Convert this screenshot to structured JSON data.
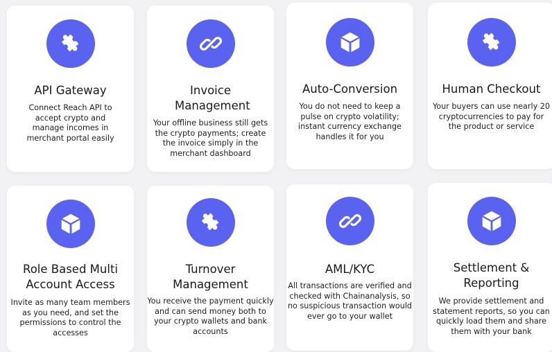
{
  "colors": {
    "page_background": "#f2f2f4",
    "card_background": "#ffffff",
    "icon_accent": "#5a63ef"
  },
  "cards": [
    {
      "icon": "puzzle-icon",
      "title": "API Gateway",
      "description": "Connect Reach API to accept crypto and manage incomes in merchant portal easily"
    },
    {
      "icon": "link-icon",
      "title": "Invoice Management",
      "description": "Your offline business still gets the crypto payments; create the invoice simply in the merchant dashboard"
    },
    {
      "icon": "cube-icon",
      "title": "Auto-Conversion",
      "description": "You do not need to keep a pulse on crypto volatility; instant currency exchange handles it for you"
    },
    {
      "icon": "puzzle-icon",
      "title": "Human Checkout",
      "description": "Your buyers can use nearly 20 cryptocurrencies to pay for the product or service"
    },
    {
      "icon": "cube-icon",
      "title": "Role Based Multi Account Access",
      "description": "Invite as many team members as you need, and set the permissions to control the accesses"
    },
    {
      "icon": "puzzle-icon",
      "title": "Turnover Management",
      "description": "You receive the payment quickly and can send money both to your crypto wallets and bank accounts"
    },
    {
      "icon": "link-icon",
      "title": "AML/KYC",
      "description": "All transactions are verified and checked with Chainanalysis, so no suspicious transaction would ever go to your wallet"
    },
    {
      "icon": "cube-icon",
      "title": "Settlement & Reporting",
      "description": "We provide settlement and statement reports, so you can quickly load them and share them with your bank"
    }
  ]
}
